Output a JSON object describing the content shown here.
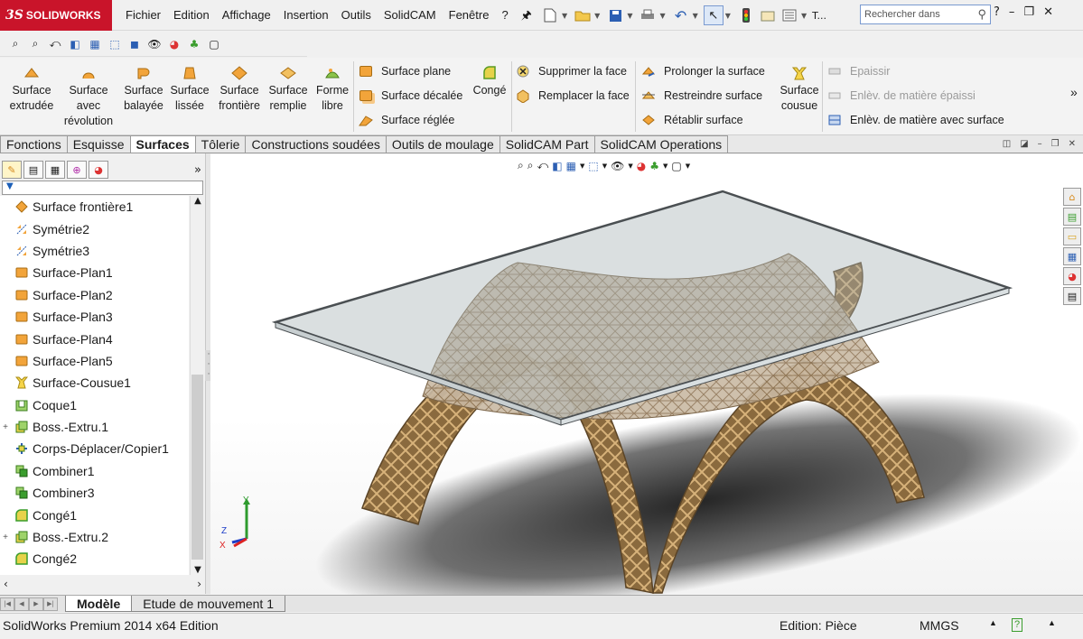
{
  "app": {
    "brand_mark": "3S",
    "brand_name": "SOLIDWORKS"
  },
  "menu": [
    "Fichier",
    "Edition",
    "Affichage",
    "Insertion",
    "Outils",
    "SolidCAM",
    "Fenêtre",
    "?"
  ],
  "quick_toolbar": {
    "truncated_label": "T..."
  },
  "search": {
    "placeholder": "Rechercher dans",
    "help": "?"
  },
  "ribbon": {
    "big_buttons": [
      {
        "label": "Surface\nextrudée",
        "icon": "surface-extrude-icon"
      },
      {
        "label": "Surface\navec\nrévolution",
        "icon": "surface-revolve-icon"
      },
      {
        "label": "Surface\nbalayée",
        "icon": "surface-sweep-icon"
      },
      {
        "label": "Surface\nlissée",
        "icon": "surface-loft-icon"
      },
      {
        "label": "Surface\nfrontière",
        "icon": "boundary-surface-icon"
      },
      {
        "label": "Surface\nremplie",
        "icon": "filled-surface-icon"
      },
      {
        "label": "Forme\nlibre",
        "icon": "freeform-icon"
      }
    ],
    "group1": [
      "Surface plane",
      "Surface décalée",
      "Surface réglée"
    ],
    "conge": "Congé",
    "group2": [
      "Supprimer la face",
      "Remplacer la face"
    ],
    "group3": [
      "Prolonger la surface",
      "Restreindre surface",
      "Rétablir surface"
    ],
    "cousue": "Surface\ncousue",
    "group4": [
      {
        "label": "Epaissir",
        "disabled": true
      },
      {
        "label": "Enlèv. de matière épaissi",
        "disabled": true
      },
      {
        "label": "Enlèv. de matière avec surface",
        "disabled": false
      }
    ],
    "more": "»"
  },
  "tabs": [
    "Fonctions",
    "Esquisse",
    "Surfaces",
    "Tôlerie",
    "Constructions soudées",
    "Outils de moulage",
    "SolidCAM Part",
    "SolidCAM Operations"
  ],
  "active_tab": "Surfaces",
  "left_panel": {
    "more": "»",
    "tree": [
      {
        "label": "Surface frontière1",
        "icon": "boundary-surface-icon",
        "expand": ""
      },
      {
        "label": "Symétrie2",
        "icon": "mirror-icon",
        "expand": ""
      },
      {
        "label": "Symétrie3",
        "icon": "mirror-icon",
        "expand": ""
      },
      {
        "label": "Surface-Plan1",
        "icon": "planar-surface-icon",
        "expand": ""
      },
      {
        "label": "Surface-Plan2",
        "icon": "planar-surface-icon",
        "expand": ""
      },
      {
        "label": "Surface-Plan3",
        "icon": "planar-surface-icon",
        "expand": ""
      },
      {
        "label": "Surface-Plan4",
        "icon": "planar-surface-icon",
        "expand": ""
      },
      {
        "label": "Surface-Plan5",
        "icon": "planar-surface-icon",
        "expand": ""
      },
      {
        "label": "Surface-Cousue1",
        "icon": "knit-surface-icon",
        "expand": ""
      },
      {
        "label": "Coque1",
        "icon": "shell-icon",
        "expand": ""
      },
      {
        "label": "Boss.-Extru.1",
        "icon": "boss-extrude-icon",
        "expand": "+"
      },
      {
        "label": "Corps-Déplacer/Copier1",
        "icon": "move-copy-body-icon",
        "expand": ""
      },
      {
        "label": "Combiner1",
        "icon": "combine-icon",
        "expand": ""
      },
      {
        "label": "Combiner3",
        "icon": "combine-icon",
        "expand": ""
      },
      {
        "label": "Congé1",
        "icon": "fillet-icon",
        "expand": ""
      },
      {
        "label": "Boss.-Extru.2",
        "icon": "boss-extrude-icon",
        "expand": "+"
      },
      {
        "label": "Congé2",
        "icon": "fillet-icon",
        "expand": ""
      }
    ]
  },
  "triad": {
    "x": "X",
    "y": "Y",
    "z": "Z"
  },
  "bottom_tabs": [
    "Modèle",
    "Etude de mouvement 1"
  ],
  "status": {
    "edition": "SolidWorks Premium 2014 x64 Edition",
    "mode": "Edition: Pièce",
    "units": "MMGS"
  },
  "colors": {
    "brand_red": "#c9142a",
    "feature_orange": "#f2a43a",
    "feature_green": "#3a9d2d",
    "wood": "#8a6a3e",
    "glass": "#a8b2b4"
  }
}
